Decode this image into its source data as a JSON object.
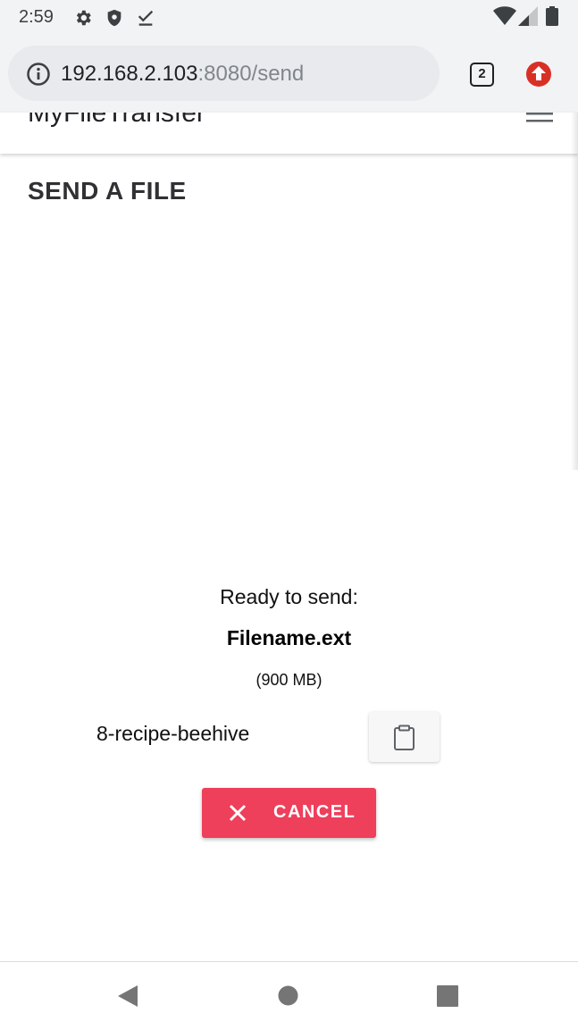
{
  "status_bar": {
    "time": "2:59",
    "icons": [
      "gear-icon",
      "shield-icon",
      "download-done-icon",
      "wifi-icon",
      "signal-icon",
      "battery-icon"
    ]
  },
  "browser": {
    "url_host": "192.168.2.103",
    "url_rest": ":8080/send",
    "tab_count": "2",
    "accent_color": "#d93025"
  },
  "site": {
    "brand": "MyFileTransfer"
  },
  "page": {
    "title": "SEND A FILE",
    "ready_text": "Ready to send:",
    "filename": "Filename.ext",
    "filesize": "(900 MB)",
    "code": "8-recipe-beehive",
    "cancel_label": "CANCEL",
    "cancel_color": "#ee3f5b"
  }
}
